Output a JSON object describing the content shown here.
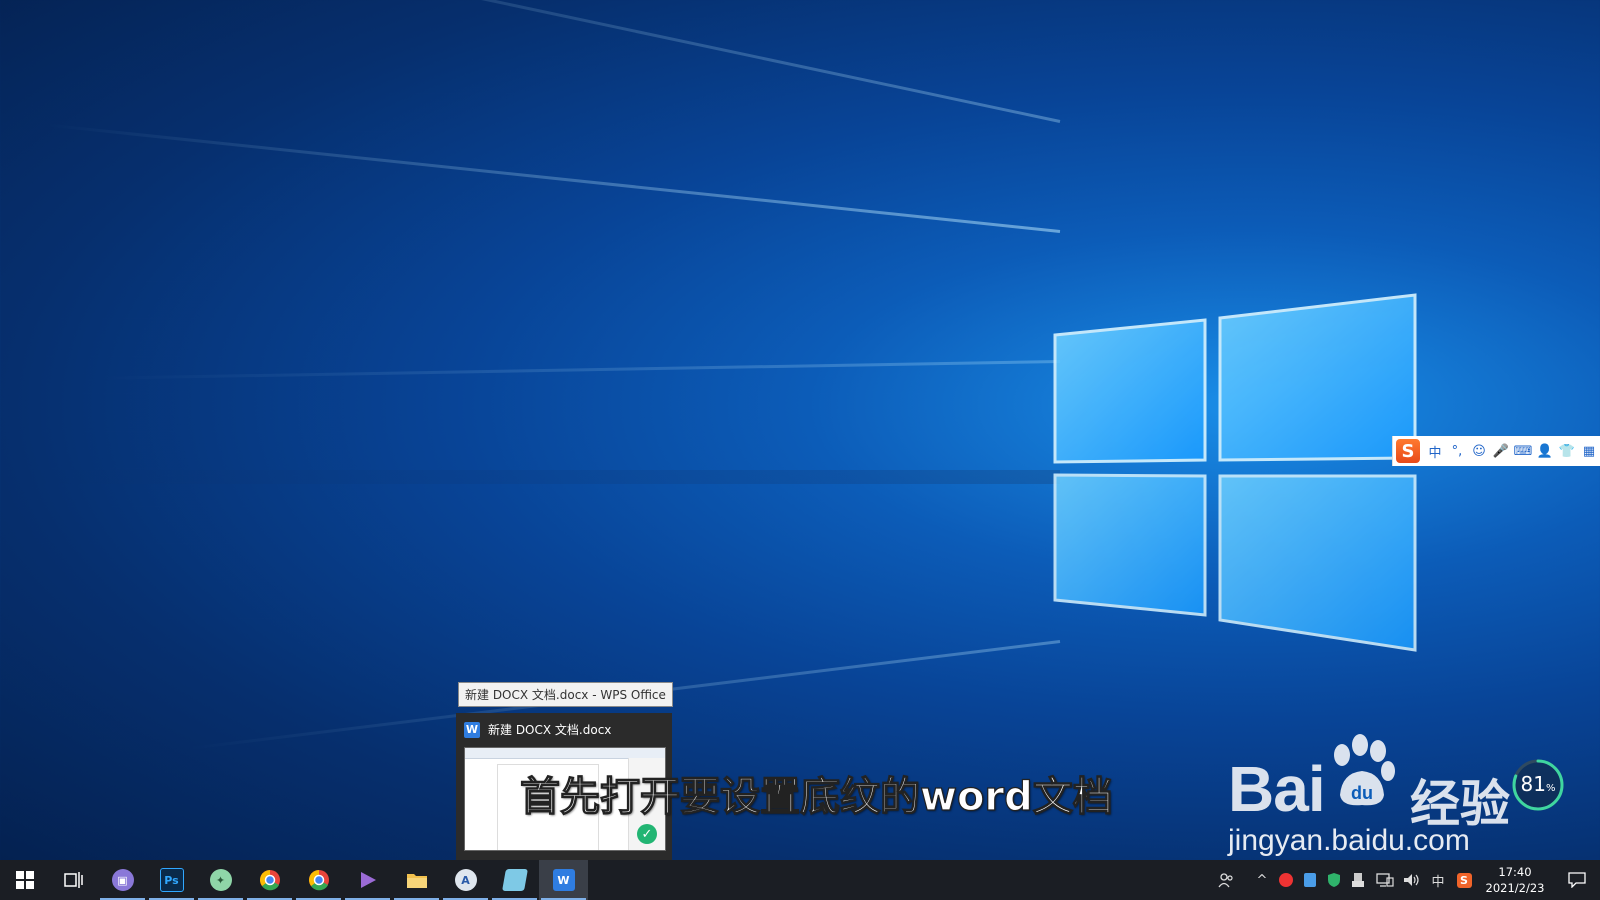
{
  "desktop": {
    "wallpaper": "Windows 10 hero light beams",
    "accent_color": "#1a8ee8"
  },
  "ime_toolbar": {
    "logo": "S",
    "items": [
      {
        "name": "ime-mode-chinese",
        "label": "中"
      },
      {
        "name": "ime-punctuation",
        "label": "°,"
      },
      {
        "name": "ime-emoji-icon",
        "label": "☺"
      },
      {
        "name": "ime-voice-icon",
        "label": "🎤"
      },
      {
        "name": "ime-keyboard-icon",
        "label": "⌨"
      },
      {
        "name": "ime-user-icon",
        "label": "👤"
      },
      {
        "name": "ime-skin-icon",
        "label": "👕"
      },
      {
        "name": "ime-toolbox-icon",
        "label": "▦"
      }
    ]
  },
  "taskbar_preview": {
    "tooltip": "新建 DOCX 文档.docx - WPS Office",
    "window_title": "新建 DOCX 文档.docx",
    "app_icon_label": "W"
  },
  "subtitle": "首先打开要设置底纹的word文档",
  "watermark": {
    "brand_prefix": "Bai",
    "brand_suffix": "du",
    "brand_cn": "经验",
    "url": "jingyan.baidu.com"
  },
  "performance_gauge": {
    "value": "81",
    "unit": "%",
    "fraction": 0.81
  },
  "taskbar": {
    "apps": [
      {
        "name": "start-button",
        "icon": "windows-icon",
        "label": "",
        "color": "#ffffff",
        "running": false
      },
      {
        "name": "task-view-button",
        "icon": "task-view-icon",
        "label": "",
        "color": "#ffffff",
        "running": false
      },
      {
        "name": "taskbar-app-save",
        "icon": "floppy-icon",
        "label": "",
        "color": "#8a78d8",
        "running": true
      },
      {
        "name": "taskbar-app-photoshop",
        "icon": "photoshop-icon",
        "label": "Ps",
        "color": "#0a2a4a",
        "running": true
      },
      {
        "name": "taskbar-app-tool",
        "icon": "compass-icon",
        "label": "",
        "color": "#8fd6a8",
        "running": true
      },
      {
        "name": "taskbar-app-chrome-1",
        "icon": "chrome-icon",
        "label": "",
        "color": "#e8453c",
        "running": true
      },
      {
        "name": "taskbar-app-chrome-2",
        "icon": "chrome-icon",
        "label": "",
        "color": "#e8453c",
        "running": true
      },
      {
        "name": "taskbar-app-player",
        "icon": "play-icon",
        "label": "",
        "color": "#9b6bd6",
        "running": true
      },
      {
        "name": "taskbar-app-explorer",
        "icon": "folder-icon",
        "label": "",
        "color": "#f2c14e",
        "running": true
      },
      {
        "name": "taskbar-app-a",
        "icon": "a-app-icon",
        "label": "A",
        "color": "#dfe6ee",
        "running": true
      },
      {
        "name": "taskbar-app-notes",
        "icon": "notes-icon",
        "label": "",
        "color": "#7ec9e6",
        "running": true
      },
      {
        "name": "taskbar-app-wps",
        "icon": "wps-icon",
        "label": "W",
        "color": "#2f7de1",
        "running": true
      }
    ],
    "tray": {
      "people_icon": "people-icon",
      "chevron": "^",
      "icons": [
        "netease-icon",
        "app-tray-icon",
        "shield-icon",
        "usb-icon"
      ],
      "network_icon": "network-icon",
      "volume_icon": "volume-icon",
      "ime_label": "中",
      "sogou_icon": "S",
      "time": "17:40",
      "date": "2021/2/23"
    }
  }
}
